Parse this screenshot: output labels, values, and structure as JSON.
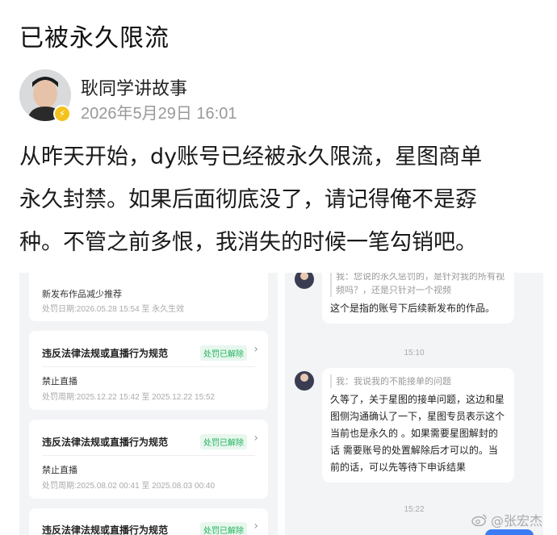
{
  "post": {
    "title": "已被永久限流",
    "author": "耿同学讲故事",
    "date": "2026年5月29日 16:01",
    "body_lines": [
      "从昨天开始，dy账号已经被永久限流，星图商单",
      "永久封禁。如果后面彻底没了，请记得俺不是孬",
      "种。不管之前多恨，我消失的时候一笔勾销吧。"
    ]
  },
  "left_screenshot": {
    "top_card": {
      "sub": "新发布作品减少推荐",
      "meta": "处罚日期:2026.05.28 15:54 至 永久生效"
    },
    "cards": [
      {
        "title": "违反法律法规或直播行为规范",
        "status": "处罚已解除",
        "sub": "禁止直播",
        "meta": "处罚周期:2025.12.22 15:42 至 2025.12.22 15:52"
      },
      {
        "title": "违反法律法规或直播行为规范",
        "status": "处罚已解除",
        "sub": "禁止直播",
        "meta": "处罚周期:2025.08.02 00:41 至 2025.08.03 00:40"
      },
      {
        "title": "违反法律法规或直播行为规范",
        "status": "处罚已解除"
      }
    ]
  },
  "right_screenshot": {
    "messages": [
      {
        "quote": "我：您说的永久惩罚的，是针对我的所有视频吗？，还是只针对一个视频",
        "text": "这个是指的账号下后续新发布的作品。"
      },
      {
        "time": "15:10"
      },
      {
        "quote": "我：我说我的不能接单的问题",
        "text": "久等了，关于星图的接单问题，这边和星图侧沟通确认了一下，星图专员表示这个当前也是永久的 。如果需要星图解封的话 需要账号的处置解除后才可以的。当前的话，可以先等待下申诉结果"
      },
      {
        "time": "15:22"
      }
    ]
  },
  "watermark": {
    "text": "@张宏杰"
  },
  "colors": {
    "status_green": "#22b35e",
    "badge_yellow": "#f4c21b",
    "chat_blue": "#3b7cf5"
  }
}
